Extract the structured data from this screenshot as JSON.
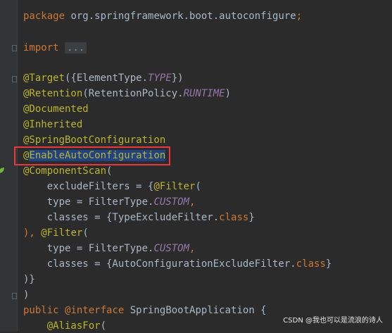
{
  "code": {
    "package_kw": "package",
    "package_name": " org.springframework.boot.autoconfigure",
    "semicolon": ";",
    "import_kw": "import",
    "import_fold": "...",
    "l_target_ann": "@Target",
    "l_target_rest1": "({ElementType.",
    "l_target_type": "TYPE",
    "l_target_rest2": "})",
    "l_retention_ann": "@Retention",
    "l_retention_rest1": "(RetentionPolicy.",
    "l_retention_runtime": "RUNTIME",
    "l_retention_rest2": ")",
    "l_documented": "@Documented",
    "l_inherited": "@Inherited",
    "l_sbc": "@SpringBootConfiguration",
    "l_eac_at": "@",
    "l_eac_rest": "EnableAutoConfiguration",
    "l_cs_ann": "@ComponentScan",
    "l_cs_paren": "(",
    "l_ef_text": "    excludeFilters = {",
    "l_ef_filter": "@Filter",
    "l_ef_paren": "(",
    "l_type1_text": "    type = FilterType.",
    "l_type1_custom": "CUSTOM",
    "l_type1_comma": ",",
    "l_classes1_text": "    classes = {TypeExcludeFilter.",
    "l_classes1_kw": "class",
    "l_classes1_end": "}",
    "l_close1_text": "), ",
    "l_close1_filter": "@Filter",
    "l_close1_paren": "(",
    "l_type2_text": "    type = FilterType.",
    "l_type2_custom": "CUSTOM",
    "l_type2_comma": ",",
    "l_classes2_text": "    classes = {AutoConfigurationExcludeFilter.",
    "l_classes2_kw": "class",
    "l_classes2_end": "}",
    "l_brace_close": ")}",
    "l_paren_close": ")",
    "l_public_kw": "public ",
    "l_interface_kw": "@interface",
    "l_class_name": " SpringBootApplication {",
    "l_aliasfor": "    @AliasFor",
    "l_aliasfor_paren": "("
  },
  "watermark": "CSDN @我也可以是流浪的诗人",
  "colors": {
    "background": "#2b2b2b",
    "keyword": "#cc7832",
    "annotation": "#bbb529",
    "constant": "#9876aa",
    "highlight_box": "#e8383d"
  }
}
